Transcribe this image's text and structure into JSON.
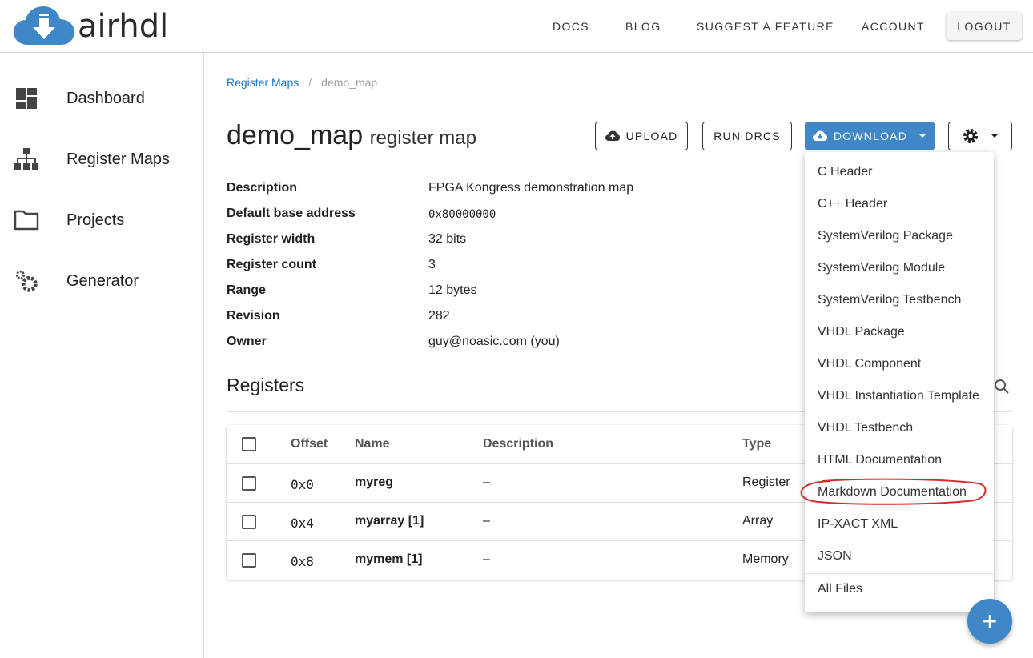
{
  "app": {
    "logo_text": "airhdl"
  },
  "nav": {
    "docs": "DOCS",
    "blog": "BLOG",
    "suggest": "SUGGEST A FEATURE",
    "account": "ACCOUNT",
    "logout": "LOGOUT"
  },
  "sidebar": {
    "items": [
      {
        "label": "Dashboard",
        "icon": "dashboard-icon"
      },
      {
        "label": "Register Maps",
        "icon": "sitemap-icon"
      },
      {
        "label": "Projects",
        "icon": "folder-icon"
      },
      {
        "label": "Generator",
        "icon": "gears-icon"
      }
    ]
  },
  "breadcrumb": {
    "parent": "Register Maps",
    "separator": "/",
    "current": "demo_map"
  },
  "title": {
    "main": "demo_map",
    "sub": "register map"
  },
  "toolbar": {
    "upload": "UPLOAD",
    "run_drcs": "RUN DRCS",
    "download": "DOWNLOAD"
  },
  "properties": [
    {
      "key": "Description",
      "value": "FPGA Kongress demonstration map"
    },
    {
      "key": "Default base address",
      "value": "0x80000000"
    },
    {
      "key": "Register width",
      "value": "32 bits"
    },
    {
      "key": "Register count",
      "value": "3"
    },
    {
      "key": "Range",
      "value": "12 bytes"
    },
    {
      "key": "Revision",
      "value": "282"
    },
    {
      "key": "Owner",
      "value": "guy@noasic.com (you)"
    }
  ],
  "registers": {
    "heading": "Registers",
    "columns": {
      "offset": "Offset",
      "name": "Name",
      "description": "Description",
      "type": "Type"
    },
    "rows": [
      {
        "offset": "0x0",
        "name": "myreg",
        "description": "–",
        "type": "Register"
      },
      {
        "offset": "0x4",
        "name": "myarray [1]",
        "description": "–",
        "type": "Array"
      },
      {
        "offset": "0x8",
        "name": "mymem [1]",
        "description": "–",
        "type": "Memory"
      }
    ]
  },
  "download_menu": {
    "items": [
      "C Header",
      "C++ Header",
      "SystemVerilog Package",
      "SystemVerilog Module",
      "SystemVerilog Testbench",
      "VHDL Package",
      "VHDL Component",
      "VHDL Instantiation Template",
      "VHDL Testbench",
      "HTML Documentation",
      "Markdown Documentation",
      "IP-XACT XML",
      "JSON"
    ],
    "all_files": "All Files",
    "highlighted_item": "Markdown Documentation"
  },
  "colors": {
    "accent": "#3f87c6",
    "link": "#1976d2",
    "annotation": "#d32f2f"
  },
  "fab": {
    "label": "+"
  }
}
